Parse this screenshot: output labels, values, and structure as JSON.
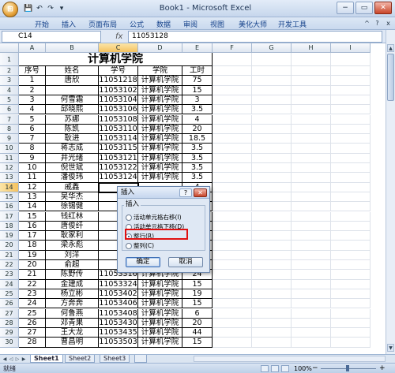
{
  "window": {
    "title": "Book1 - Microsoft Excel",
    "office_button": "⊞",
    "qat": [
      "💾",
      "↶",
      "↷",
      "▾"
    ],
    "min": "−",
    "max": "▭",
    "close": "✕"
  },
  "ribbon": {
    "tabs": [
      "开始",
      "插入",
      "页面布局",
      "公式",
      "数据",
      "审阅",
      "视图",
      "美化大师",
      "开发工具"
    ]
  },
  "formula_bar": {
    "name_box": "C14",
    "fx": "fx",
    "value": "11053128"
  },
  "columns": [
    "A",
    "B",
    "C",
    "D",
    "E",
    "F",
    "G",
    "H",
    "I"
  ],
  "sheet": {
    "title": "计算机学院",
    "headers": [
      "序号",
      "姓名",
      "学号",
      "学院",
      "工时"
    ],
    "rows": [
      [
        "1",
        "唐欣",
        "11051218",
        "计算机学院",
        "75"
      ],
      [
        "2",
        "",
        "11053102",
        "计算机学院",
        "15"
      ],
      [
        "3",
        "何雪霜",
        "11053104",
        "计算机学院",
        "3"
      ],
      [
        "4",
        "邱晓熙",
        "11053106",
        "计算机学院",
        "3.5"
      ],
      [
        "5",
        "苏娜",
        "11053108",
        "计算机学院",
        "4"
      ],
      [
        "6",
        "陈凯",
        "11053110",
        "计算机学院",
        "20"
      ],
      [
        "7",
        "耿进",
        "11053114",
        "计算机学院",
        "18.5"
      ],
      [
        "8",
        "蒋志成",
        "11053115",
        "计算机学院",
        "3.5"
      ],
      [
        "9",
        "井光绪",
        "11053121",
        "计算机学院",
        "3.5"
      ],
      [
        "10",
        "倪世斌",
        "11053122",
        "计算机学院",
        "3.5"
      ],
      [
        "11",
        "潘俊玮",
        "11053124",
        "计算机学院",
        "3.5"
      ],
      [
        "12",
        "戚鑫",
        "",
        "",
        "4"
      ],
      [
        "13",
        "吴华杰",
        "",
        "",
        "30"
      ],
      [
        "14",
        "徐锡健",
        "",
        "",
        "20"
      ],
      [
        "15",
        "钱红林",
        "",
        "",
        "20"
      ],
      [
        "16",
        "唐俊纤",
        "",
        "",
        "15"
      ],
      [
        "17",
        "耿家利",
        "",
        "",
        "15.5"
      ],
      [
        "18",
        "梁永彪",
        "",
        "",
        "15"
      ],
      [
        "19",
        "刘洋",
        "",
        "",
        "20"
      ],
      [
        "20",
        "俞超",
        "",
        "",
        "32"
      ],
      [
        "21",
        "陈野传",
        "11053316",
        "计算机学院",
        "24"
      ],
      [
        "22",
        "金建成",
        "11053324",
        "计算机学院",
        "15"
      ],
      [
        "23",
        "杨立彬",
        "11053402",
        "计算机学院",
        "19"
      ],
      [
        "24",
        "方奔奔",
        "11053406",
        "计算机学院",
        "15"
      ],
      [
        "25",
        "何鲁燕",
        "11053408",
        "计算机学院",
        "6"
      ],
      [
        "26",
        "邓青果",
        "11053430",
        "计算机学院",
        "20"
      ],
      [
        "27",
        "王大龙",
        "11053435",
        "计算机学院",
        "44"
      ],
      [
        "28",
        "曹昌明",
        "11053503",
        "计算机学院",
        "15"
      ]
    ]
  },
  "dialog": {
    "title": "插入",
    "help": "?",
    "close": "✕",
    "group_label": "插入",
    "options": [
      {
        "label": "活动单元格右移(I)",
        "checked": false
      },
      {
        "label": "活动单元格下移(D)",
        "checked": false
      },
      {
        "label": "整行(R)",
        "checked": true
      },
      {
        "label": "整列(C)",
        "checked": false
      }
    ],
    "ok": "确定",
    "cancel": "取消"
  },
  "sheet_tabs": [
    "Sheet1",
    "Sheet2",
    "Sheet3"
  ],
  "status": {
    "text": "就绪",
    "zoom": "100%",
    "minus": "−",
    "plus": "+"
  }
}
